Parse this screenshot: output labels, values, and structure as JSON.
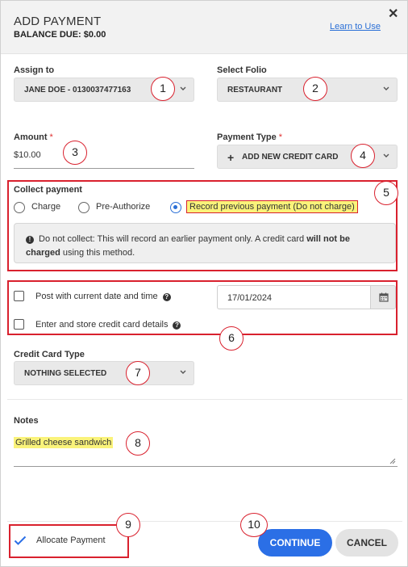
{
  "header": {
    "title": "ADD PAYMENT",
    "balance_label": "BALANCE DUE:",
    "balance_value": "$0.00",
    "learn_link": "Learn to Use",
    "close": "✕"
  },
  "assign_to": {
    "label": "Assign to",
    "value": "JANE DOE - 0130037477163"
  },
  "folio": {
    "label": "Select Folio",
    "value": "RESTAURANT"
  },
  "amount": {
    "label": "Amount",
    "required_mark": "*",
    "value": "$10.00"
  },
  "payment_type": {
    "label": "Payment Type",
    "required_mark": "*",
    "value": "ADD NEW CREDIT CARD",
    "plus": "+"
  },
  "collect_payment": {
    "label": "Collect payment",
    "options": [
      "Charge",
      "Pre-Authorize",
      "Record previous payment (Do not charge)"
    ],
    "selected": "Record previous payment (Do not charge)",
    "info_line1_a": "Do not collect: This will record an earlier payment only. A credit card ",
    "info_line1_b": "will not be",
    "info_line2_a": "charged",
    "info_line2_b": " using this method."
  },
  "post_current": {
    "label": "Post with current date and time",
    "date": "17/01/2024"
  },
  "store_card": {
    "label": "Enter and store credit card details"
  },
  "card_type": {
    "label": "Credit Card Type",
    "value": "NOTHING SELECTED"
  },
  "notes": {
    "label": "Notes",
    "value": "Grilled cheese sandwich"
  },
  "allocate": {
    "label": "Allocate Payment",
    "checked": true
  },
  "buttons": {
    "continue": "CONTINUE",
    "cancel": "CANCEL"
  },
  "callouts": [
    "1",
    "2",
    "3",
    "4",
    "5",
    "6",
    "7",
    "8",
    "9",
    "10"
  ],
  "colors": {
    "accent": "#2b6fe6",
    "annotation_red": "#d9212e",
    "highlight": "#faf37a"
  },
  "icons": {
    "chevron": "chevron-down-icon",
    "calendar": "calendar-icon",
    "info": "info-icon",
    "help": "question-icon",
    "check": "check-icon",
    "close": "close-icon"
  }
}
